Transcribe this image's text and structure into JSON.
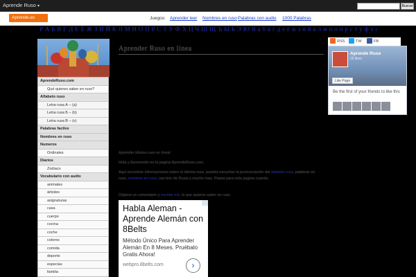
{
  "topbar": {
    "brand": "Aprende Ruso",
    "caret": "▾",
    "search_button": "Buscar"
  },
  "nav": {
    "logo_label": "Aprende.es",
    "games_label": "Juegos:",
    "games": [
      "Aprender leer",
      "Nombres en ruso",
      "Palabras con audio",
      "1000 Palabras"
    ]
  },
  "marquee": "Р А Б В Г Д Е Ё Ж З И Й К Л М Н О П Р С Т У Ф Х Ц Ч Ш Щ Ъ Ы Ь Э Ю Я а б в г д е ё ж з и й к л м н о п р с т у ф х ц ч ш щ ъ ы ь э ю я",
  "sidebar": {
    "items": [
      {
        "label": "AprendeRuso.com",
        "level": "top"
      },
      {
        "label": "Qué quieres saber en ruso?",
        "level": "sub"
      },
      {
        "label": "Alfabeto ruso",
        "level": "top"
      },
      {
        "label": "Letra rusa А – (a)",
        "level": "sub"
      },
      {
        "label": "Letra rusa Б – (b)",
        "level": "sub"
      },
      {
        "label": "Letra rusa В – (v)",
        "level": "sub"
      },
      {
        "label": "Palabras faciles",
        "level": "top"
      },
      {
        "label": "Nombres en ruso",
        "level": "top"
      },
      {
        "label": "Numeros",
        "level": "top"
      },
      {
        "label": "Ordinales",
        "level": "sub"
      },
      {
        "label": "Diarios",
        "level": "top"
      },
      {
        "label": "Zodiaco",
        "level": "sub"
      },
      {
        "label": "Vocabulario con audio",
        "level": "top"
      },
      {
        "label": "animales",
        "level": "sub"
      },
      {
        "label": "árboles",
        "level": "sub"
      },
      {
        "label": "asignaturas",
        "level": "sub"
      },
      {
        "label": "casa",
        "level": "sub"
      },
      {
        "label": "cuerpo",
        "level": "sub"
      },
      {
        "label": "cocina",
        "level": "sub"
      },
      {
        "label": "coche",
        "level": "sub"
      },
      {
        "label": "colores",
        "level": "sub"
      },
      {
        "label": "comida",
        "level": "sub"
      },
      {
        "label": "deporte",
        "level": "sub"
      },
      {
        "label": "especias",
        "level": "sub"
      },
      {
        "label": "familia",
        "level": "sub"
      },
      {
        "label": "flores",
        "level": "sub"
      }
    ]
  },
  "main": {
    "title": "Aprender Ruso en línea",
    "para1": "Aprender idioma ruso en línea!",
    "para2": "Hola y bienvenido en la pagina AprendeRuso.com,",
    "para3_a": "Aquí encontrar informaciones sobre el idioma ruso, puedes escuchar la pronunciación del ",
    "para3_link1": "alfabeto ruso",
    "para3_b": ", palabras en ruso, ",
    "para3_link2": "nombres en ruso",
    "para3_c": ", vas leer de Rusia y mucho mas. Pasea para esta pagina cuando.",
    "para4_a": "Déjame un comentario y ",
    "para4_link": "escribe me",
    "para4_b": ", lo que quieres saber en ruso."
  },
  "ad": {
    "title": "Habla Aleman - Aprende Alemán con 8Belts",
    "desc": "Método Único Para Aprender Alemán En 8 Meses. Pruébalo Gratis Ahora!",
    "url": "webpro.8belts.com",
    "arrow": "›"
  },
  "social": {
    "items": [
      {
        "label": "RSS",
        "color": "#f26522"
      },
      {
        "label": "TW",
        "color": "#1da1f2"
      },
      {
        "label": "FB",
        "color": "#3b5998"
      }
    ]
  },
  "fb_widget": {
    "name": "Aprende Ruso",
    "likes": "25 likes",
    "like_button": "Like Page",
    "friends_text": "Be the first of your friends to like this"
  }
}
